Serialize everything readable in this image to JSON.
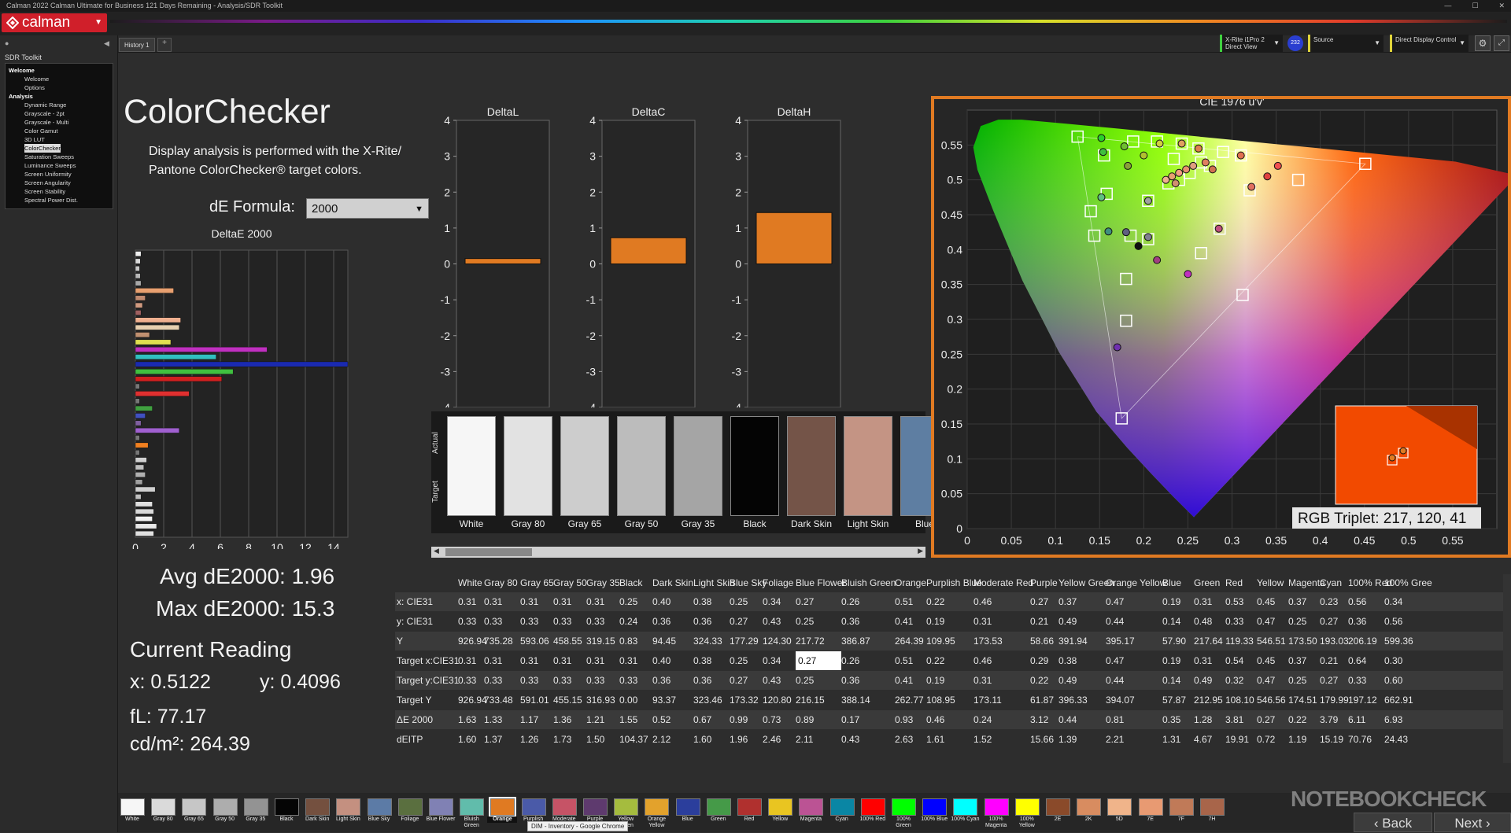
{
  "titlebar": {
    "title": "Calman 2022 Calman Ultimate for Business 121 Days Remaining - Analysis/SDR Toolkit",
    "minimize": "—",
    "maximize": "☐",
    "close": "✕"
  },
  "logo": "calman",
  "history_tab": "History 1",
  "devices": [
    {
      "line1": "X-Rite i1Pro 2",
      "line2": "Direct View",
      "badge": "232",
      "accent": "#3fd13f"
    },
    {
      "line1": "Source",
      "line2": "",
      "accent": "#e0d43a"
    },
    {
      "line1": "Direct Display Control",
      "line2": "",
      "accent": "#e0d43a"
    }
  ],
  "sidebar": {
    "title": "SDR Toolkit",
    "tree": [
      {
        "label": "Welcome",
        "group": true
      },
      {
        "label": "Welcome"
      },
      {
        "label": "Options"
      },
      {
        "label": "Analysis",
        "group": true
      },
      {
        "label": "Dynamic Range"
      },
      {
        "label": "Grayscale - 2pt"
      },
      {
        "label": "Grayscale - Multi"
      },
      {
        "label": "Color Gamut"
      },
      {
        "label": "3D LUT"
      },
      {
        "label": "ColorChecker",
        "selected": true
      },
      {
        "label": "Saturation Sweeps"
      },
      {
        "label": "Luminance Sweeps"
      },
      {
        "label": "Screen Uniformity"
      },
      {
        "label": "Screen Angularity"
      },
      {
        "label": "Screen Stability"
      },
      {
        "label": "Spectral Power Dist."
      }
    ]
  },
  "main": {
    "heading": "ColorChecker",
    "desc_line1": "Display analysis is performed with the X-Rite/",
    "desc_line2": "Pantone ColorChecker® target colors.",
    "formula_label": "dE Formula:",
    "formula_value": "2000",
    "avg": "Avg dE2000: 1.96",
    "max": "Max dE2000: 15.3",
    "current_reading": "Current Reading",
    "x": "x: 0.5122",
    "y": "y: 0.4096",
    "fl": "fL: 77.17",
    "cdm2": "cd/m²: 264.39"
  },
  "deltae_chart": {
    "title": "DeltaE 2000",
    "xticks": [
      "0",
      "2",
      "4",
      "6",
      "8",
      "10",
      "12",
      "14"
    ],
    "xlim": [
      0,
      15
    ],
    "bars": [
      {
        "v": 0.4,
        "c": "#f0f0f0"
      },
      {
        "v": 0.35,
        "c": "#d8d8d8"
      },
      {
        "v": 0.3,
        "c": "#c8c8c8"
      },
      {
        "v": 0.35,
        "c": "#b8b8b8"
      },
      {
        "v": 0.4,
        "c": "#a8a8a8"
      },
      {
        "v": 2.7,
        "c": "#e8a070"
      },
      {
        "v": 0.7,
        "c": "#c08a70"
      },
      {
        "v": 0.5,
        "c": "#d09a80"
      },
      {
        "v": 0.4,
        "c": "#a06060"
      },
      {
        "v": 3.2,
        "c": "#f0b090"
      },
      {
        "v": 3.1,
        "c": "#e8d0b0"
      },
      {
        "v": 1.0,
        "c": "#c09070"
      },
      {
        "v": 2.5,
        "c": "#e0e050"
      },
      {
        "v": 9.3,
        "c": "#c030c0"
      },
      {
        "v": 5.7,
        "c": "#30c0c0"
      },
      {
        "v": 15.3,
        "c": "#1a2ab0"
      },
      {
        "v": 6.9,
        "c": "#40c040"
      },
      {
        "v": 6.1,
        "c": "#d02020"
      },
      {
        "v": 0.3,
        "c": "#777777"
      },
      {
        "v": 3.8,
        "c": "#e03030"
      },
      {
        "v": 0.3,
        "c": "#777777"
      },
      {
        "v": 1.2,
        "c": "#40a040"
      },
      {
        "v": 0.7,
        "c": "#4050c0"
      },
      {
        "v": 0.4,
        "c": "#8060a0"
      },
      {
        "v": 3.1,
        "c": "#a060d0"
      },
      {
        "v": 0.3,
        "c": "#777777"
      },
      {
        "v": 0.9,
        "c": "#f08020"
      },
      {
        "v": 0.3,
        "c": "#777777"
      },
      {
        "v": 0.8,
        "c": "#d0d0d0"
      },
      {
        "v": 0.6,
        "c": "#c0c0c0"
      },
      {
        "v": 0.7,
        "c": "#b0b0b0"
      },
      {
        "v": 0.5,
        "c": "#a0a0a0"
      },
      {
        "v": 1.4,
        "c": "#d0d0d0"
      },
      {
        "v": 0.4,
        "c": "#c0c0c0"
      },
      {
        "v": 1.2,
        "c": "#e0e0e0"
      },
      {
        "v": 1.3,
        "c": "#d8d8d8"
      },
      {
        "v": 1.2,
        "c": "#f0f0f0"
      },
      {
        "v": 1.5,
        "c": "#e8e8e8"
      },
      {
        "v": 1.3,
        "c": "#e0e0e0"
      }
    ]
  },
  "delta_charts": [
    {
      "title": "DeltaL",
      "value": 0.15,
      "yticks": [
        "4",
        "3",
        "2",
        "1",
        "0",
        "-1",
        "-2",
        "-3",
        "-4"
      ],
      "ylim": [
        -4,
        4
      ]
    },
    {
      "title": "DeltaC",
      "value": 0.73,
      "yticks": [
        "4",
        "3",
        "2",
        "1",
        "0",
        "-1",
        "-2",
        "-3",
        "-4"
      ],
      "ylim": [
        -4,
        4
      ]
    },
    {
      "title": "DeltaH",
      "value": 1.43,
      "yticks": [
        "4",
        "3",
        "2",
        "1",
        "0",
        "-1",
        "-2",
        "-3",
        "-4"
      ],
      "ylim": [
        -4,
        4
      ]
    }
  ],
  "swatches": {
    "actual_label": "Actual",
    "target_label": "Target",
    "items": [
      {
        "label": "White",
        "color": "#f6f6f6"
      },
      {
        "label": "Gray 80",
        "color": "#e2e2e2"
      },
      {
        "label": "Gray 65",
        "color": "#cdcdcd"
      },
      {
        "label": "Gray 50",
        "color": "#bcbcbc"
      },
      {
        "label": "Gray 35",
        "color": "#a5a5a5"
      },
      {
        "label": "Black",
        "color": "#040404"
      },
      {
        "label": "Dark Skin",
        "color": "#745448"
      },
      {
        "label": "Light Skin",
        "color": "#c49484"
      },
      {
        "label": "Blue",
        "color": "#5e7ea2"
      }
    ]
  },
  "cie": {
    "title": "CIE 1976 u'v'",
    "xticks": [
      "0",
      "0.05",
      "0.1",
      "0.15",
      "0.2",
      "0.25",
      "0.3",
      "0.35",
      "0.4",
      "0.45",
      "0.5",
      "0.55"
    ],
    "yticks": [
      "0",
      "0.05",
      "0.1",
      "0.15",
      "0.2",
      "0.25",
      "0.3",
      "0.35",
      "0.4",
      "0.45",
      "0.5",
      "0.55"
    ],
    "xlim": [
      0,
      0.6
    ],
    "ylim": [
      0,
      0.6
    ],
    "rgb_triplet": "RGB Triplet: 217, 120, 41",
    "gamut_triangle": [
      [
        0.451,
        0.523
      ],
      [
        0.125,
        0.562
      ],
      [
        0.175,
        0.158
      ]
    ],
    "targets": [
      [
        0.125,
        0.562
      ],
      [
        0.451,
        0.523
      ],
      [
        0.175,
        0.158
      ],
      [
        0.205,
        0.47
      ],
      [
        0.262,
        0.545
      ],
      [
        0.31,
        0.535
      ],
      [
        0.375,
        0.5
      ],
      [
        0.32,
        0.485
      ],
      [
        0.265,
        0.395
      ],
      [
        0.312,
        0.335
      ],
      [
        0.18,
        0.358
      ],
      [
        0.18,
        0.298
      ],
      [
        0.185,
        0.42
      ],
      [
        0.205,
        0.415
      ],
      [
        0.144,
        0.42
      ],
      [
        0.158,
        0.48
      ],
      [
        0.14,
        0.455
      ],
      [
        0.215,
        0.555
      ],
      [
        0.243,
        0.552
      ],
      [
        0.286,
        0.43
      ],
      [
        0.234,
        0.53
      ],
      [
        0.265,
        0.525
      ],
      [
        0.252,
        0.51
      ],
      [
        0.24,
        0.5
      ],
      [
        0.228,
        0.495
      ],
      [
        0.275,
        0.52
      ],
      [
        0.155,
        0.535
      ],
      [
        0.188,
        0.555
      ],
      [
        0.29,
        0.54
      ]
    ],
    "readings": [
      [
        0.152,
        0.56
      ],
      [
        0.178,
        0.548
      ],
      [
        0.154,
        0.54
      ],
      [
        0.182,
        0.52
      ],
      [
        0.2,
        0.535
      ],
      [
        0.218,
        0.552
      ],
      [
        0.243,
        0.552
      ],
      [
        0.262,
        0.545
      ],
      [
        0.152,
        0.475
      ],
      [
        0.205,
        0.47
      ],
      [
        0.16,
        0.426
      ],
      [
        0.18,
        0.425
      ],
      [
        0.205,
        0.418
      ],
      [
        0.194,
        0.405
      ],
      [
        0.215,
        0.385
      ],
      [
        0.25,
        0.365
      ],
      [
        0.34,
        0.505
      ],
      [
        0.352,
        0.52
      ],
      [
        0.31,
        0.535
      ],
      [
        0.322,
        0.49
      ],
      [
        0.285,
        0.43
      ],
      [
        0.17,
        0.26
      ],
      [
        0.225,
        0.5
      ],
      [
        0.232,
        0.505
      ],
      [
        0.24,
        0.51
      ],
      [
        0.248,
        0.515
      ],
      [
        0.256,
        0.52
      ],
      [
        0.236,
        0.495
      ],
      [
        0.27,
        0.525
      ],
      [
        0.278,
        0.515
      ]
    ],
    "reading_colors": [
      "#2ad12a",
      "#6fbf30",
      "#3fbf3f",
      "#8aa03a",
      "#b0c030",
      "#d0d040",
      "#e0a060",
      "#e08050",
      "#5fc080",
      "#a0a0a0",
      "#3f8f7f",
      "#606080",
      "#808090",
      "#101010",
      "#a04080",
      "#c030c0",
      "#e04040",
      "#f05050",
      "#e07050",
      "#e07060",
      "#c05080",
      "#7030b0",
      "#f0b090",
      "#e8a070",
      "#f0a080",
      "#e89070",
      "#e0a080",
      "#d09070",
      "#e08060",
      "#d07050"
    ]
  },
  "table": {
    "columns": [
      "White",
      "Gray 80",
      "Gray 65",
      "Gray 50",
      "Gray 35",
      "Black",
      "Dark Skin",
      "Light Skin",
      "Blue Sky",
      "Foliage",
      "Blue Flower",
      "Bluish Green",
      "Orange",
      "Purplish Blue",
      "Moderate Red",
      "Purple",
      "Yellow Green",
      "Orange Yellow",
      "Blue",
      "Green",
      "Red",
      "Yellow",
      "Magenta",
      "Cyan",
      "100% Red",
      "100% Gree"
    ],
    "rows": [
      {
        "label": "x: CIE31",
        "values": [
          "0.31",
          "0.31",
          "0.31",
          "0.31",
          "0.31",
          "0.25",
          "0.40",
          "0.38",
          "0.25",
          "0.34",
          "0.27",
          "0.26",
          "0.51",
          "0.22",
          "0.46",
          "0.27",
          "0.37",
          "0.47",
          "0.19",
          "0.31",
          "0.53",
          "0.45",
          "0.37",
          "0.23",
          "0.56",
          "0.34"
        ]
      },
      {
        "label": "y: CIE31",
        "values": [
          "0.33",
          "0.33",
          "0.33",
          "0.33",
          "0.33",
          "0.24",
          "0.36",
          "0.36",
          "0.27",
          "0.43",
          "0.25",
          "0.36",
          "0.41",
          "0.19",
          "0.31",
          "0.21",
          "0.49",
          "0.44",
          "0.14",
          "0.48",
          "0.33",
          "0.47",
          "0.25",
          "0.27",
          "0.36",
          "0.56"
        ]
      },
      {
        "label": "Y",
        "values": [
          "926.94",
          "735.28",
          "593.06",
          "458.55",
          "319.15",
          "0.83",
          "94.45",
          "324.33",
          "177.29",
          "124.30",
          "217.72",
          "386.87",
          "264.39",
          "109.95",
          "173.53",
          "58.66",
          "391.94",
          "395.17",
          "57.90",
          "217.64",
          "119.33",
          "546.51",
          "173.50",
          "193.03",
          "206.19",
          "599.36"
        ]
      },
      {
        "label": "Target x:CIE31",
        "values": [
          "0.31",
          "0.31",
          "0.31",
          "0.31",
          "0.31",
          "0.31",
          "0.40",
          "0.38",
          "0.25",
          "0.34",
          "0.27",
          "0.26",
          "0.51",
          "0.22",
          "0.46",
          "0.29",
          "0.38",
          "0.47",
          "0.19",
          "0.31",
          "0.54",
          "0.45",
          "0.37",
          "0.21",
          "0.64",
          "0.30"
        ]
      },
      {
        "label": "Target y:CIE31",
        "values": [
          "0.33",
          "0.33",
          "0.33",
          "0.33",
          "0.33",
          "0.33",
          "0.36",
          "0.36",
          "0.27",
          "0.43",
          "0.25",
          "0.36",
          "0.41",
          "0.19",
          "0.31",
          "0.22",
          "0.49",
          "0.44",
          "0.14",
          "0.49",
          "0.32",
          "0.47",
          "0.25",
          "0.27",
          "0.33",
          "0.60"
        ]
      },
      {
        "label": "Target Y",
        "values": [
          "926.94",
          "733.48",
          "591.01",
          "455.15",
          "316.93",
          "0.00",
          "93.37",
          "323.46",
          "173.32",
          "120.80",
          "216.15",
          "388.14",
          "262.77",
          "108.95",
          "173.11",
          "61.87",
          "396.33",
          "394.07",
          "57.87",
          "212.95",
          "108.10",
          "546.56",
          "174.51",
          "179.99",
          "197.12",
          "662.91"
        ]
      },
      {
        "label": "ΔE 2000",
        "values": [
          "1.63",
          "1.33",
          "1.17",
          "1.36",
          "1.21",
          "1.55",
          "0.52",
          "0.67",
          "0.99",
          "0.73",
          "0.89",
          "0.17",
          "0.93",
          "0.46",
          "0.24",
          "3.12",
          "0.44",
          "0.81",
          "0.35",
          "1.28",
          "3.81",
          "0.27",
          "0.22",
          "3.79",
          "6.11",
          "6.93"
        ]
      },
      {
        "label": "dEITP",
        "values": [
          "1.60",
          "1.37",
          "1.26",
          "1.73",
          "1.50",
          "104.37",
          "2.12",
          "1.60",
          "1.96",
          "2.46",
          "2.11",
          "0.43",
          "2.63",
          "1.61",
          "1.52",
          "15.66",
          "1.39",
          "2.21",
          "1.31",
          "4.67",
          "19.91",
          "0.72",
          "1.19",
          "15.19",
          "70.76",
          "24.43"
        ]
      }
    ]
  },
  "bottom": {
    "swatches": [
      {
        "label": "White",
        "color": "#f6f6f6"
      },
      {
        "label": "Gray 80",
        "color": "#dadada"
      },
      {
        "label": "Gray 65",
        "color": "#c6c6c6"
      },
      {
        "label": "Gray 50",
        "color": "#adadad"
      },
      {
        "label": "Gray 35",
        "color": "#939393"
      },
      {
        "label": "Black",
        "color": "#050505"
      },
      {
        "label": "Dark Skin",
        "color": "#74503f"
      },
      {
        "label": "Light Skin",
        "color": "#c49080"
      },
      {
        "label": "Blue Sky",
        "color": "#5c7ba6"
      },
      {
        "label": "Foliage",
        "color": "#5a6f3f"
      },
      {
        "label": "Blue Flower",
        "color": "#8081b4"
      },
      {
        "label": "Bluish Green",
        "color": "#61bcab"
      },
      {
        "label": "Orange",
        "color": "#e07a22"
      },
      {
        "label": "Purplish Blue",
        "color": "#4a5aa8"
      },
      {
        "label": "Moderate Red",
        "color": "#c65366"
      },
      {
        "label": "Purple",
        "color": "#5e3a6e"
      },
      {
        "label": "Yellow Green",
        "color": "#a5bc3e"
      },
      {
        "label": "Orange Yellow",
        "color": "#e3a22c"
      },
      {
        "label": "Blue",
        "color": "#2b3e9c"
      },
      {
        "label": "Green",
        "color": "#459a48"
      },
      {
        "label": "Red",
        "color": "#b0302e"
      },
      {
        "label": "Yellow",
        "color": "#e9c521"
      },
      {
        "label": "Magenta",
        "color": "#bb5394"
      },
      {
        "label": "Cyan",
        "color": "#0a86a4"
      },
      {
        "label": "100% Red",
        "color": "#ff0000"
      },
      {
        "label": "100% Green",
        "color": "#00ff00"
      },
      {
        "label": "100% Blue",
        "color": "#0000ff"
      },
      {
        "label": "100% Cyan",
        "color": "#00ffff"
      },
      {
        "label": "100% Magenta",
        "color": "#ff00ff"
      },
      {
        "label": "100% Yellow",
        "color": "#ffff00"
      },
      {
        "label": "2E",
        "color": "#8a4a2a"
      },
      {
        "label": "2K",
        "color": "#d88c60"
      },
      {
        "label": "5D",
        "color": "#f0b48a"
      },
      {
        "label": "7E",
        "color": "#e89a72"
      },
      {
        "label": "7F",
        "color": "#c07a58"
      },
      {
        "label": "7H",
        "color": "#a8654a"
      }
    ],
    "selected": "Orange",
    "tooltip": "DIM - Inventory - Google Chrome",
    "back": "Back",
    "next": "Next",
    "watermark": "NOTEBOOKCHECK"
  }
}
